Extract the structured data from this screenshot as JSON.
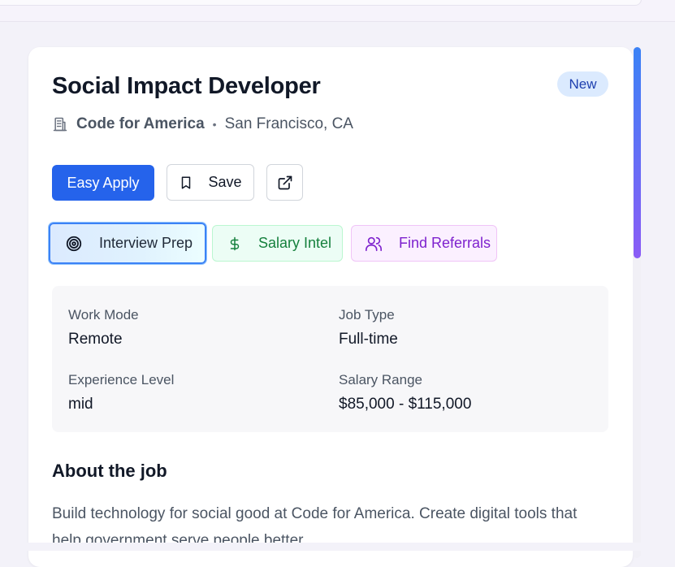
{
  "job": {
    "title": "Social Impact Developer",
    "badge": "New",
    "company": "Code for America",
    "separator": "•",
    "location": "San Francisco, CA"
  },
  "actions": {
    "apply_label": "Easy Apply",
    "save_label": "Save"
  },
  "tools": {
    "interview_label": "Interview Prep",
    "salary_label": "Salary Intel",
    "referrals_label": "Find Referrals"
  },
  "details": {
    "work_mode_label": "Work Mode",
    "work_mode_value": "Remote",
    "job_type_label": "Job Type",
    "job_type_value": "Full-time",
    "experience_label": "Experience Level",
    "experience_value": "mid",
    "salary_label": "Salary Range",
    "salary_value": "$85,000 - $115,000"
  },
  "about": {
    "heading": "About the job",
    "text": "Build technology for social good at Code for America. Create digital tools that help government serve people better."
  },
  "icons": {
    "company": "building-icon",
    "save": "bookmark-icon",
    "external": "external-link-icon",
    "interview": "target-icon",
    "salary": "dollar-icon",
    "referrals": "users-icon"
  },
  "colors": {
    "primary": "#2563eb",
    "badge_bg": "#dbeafe",
    "badge_text": "#1e40af",
    "salary_green": "#15803d",
    "referral_purple": "#7e22ce",
    "scroll_gradient_start": "#3b82f6",
    "scroll_gradient_end": "#8b5cf6"
  }
}
